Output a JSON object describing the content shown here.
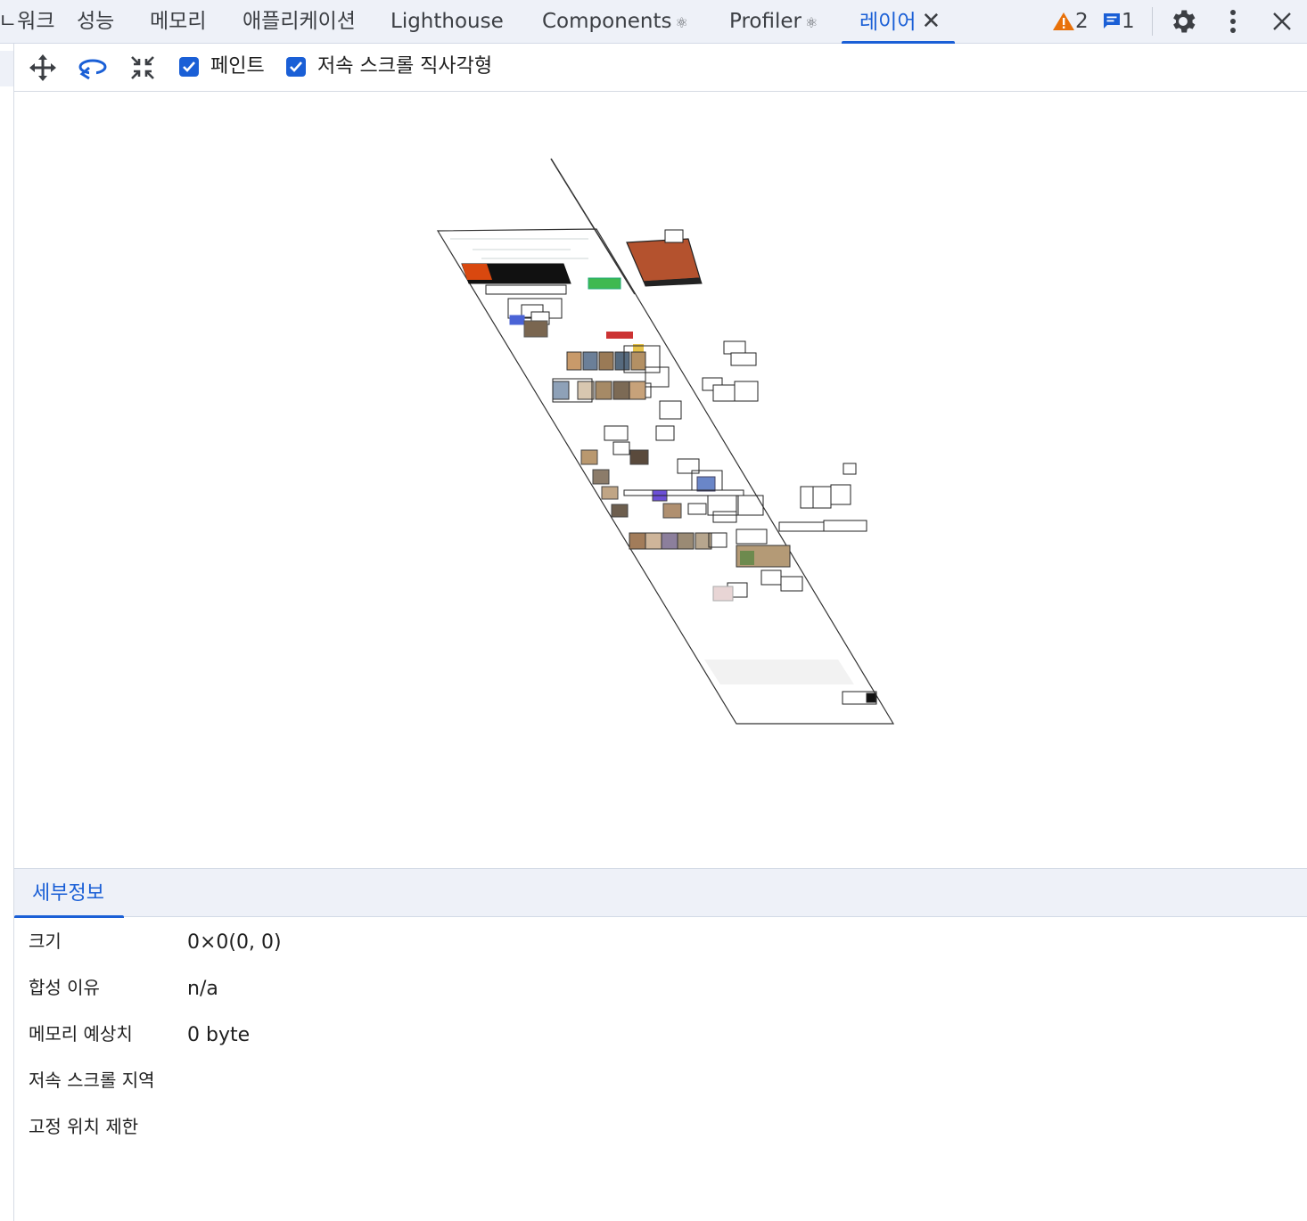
{
  "tabs": [
    {
      "label": "ㄴ워크"
    },
    {
      "label": "성능"
    },
    {
      "label": "메모리"
    },
    {
      "label": "애플리케이션"
    },
    {
      "label": "Lighthouse"
    },
    {
      "label": "Components",
      "react_icon": "⚛"
    },
    {
      "label": "Profiler",
      "react_icon": "⚛"
    },
    {
      "label": "레이어",
      "close_icon": "✕"
    }
  ],
  "status": {
    "warnings": "2",
    "messages": "1"
  },
  "toolbar": {
    "pan_icon": "move-icon",
    "rotate_icon": "rotate-icon",
    "reset_icon": "reset-transform-icon",
    "paint_label": "페인트",
    "slow_scroll_label": "저속 스크롤 직사각형"
  },
  "details": {
    "tab_label": "세부정보",
    "rows": [
      {
        "key": "크기",
        "value": "0×0(0, 0)"
      },
      {
        "key": "합성 이유",
        "value": "n/a"
      },
      {
        "key": "메모리 예상치",
        "value": "0 byte"
      },
      {
        "key": "저속 스크롤 지역",
        "value": ""
      },
      {
        "key": "고정 위치 제한",
        "value": ""
      }
    ]
  },
  "colors": {
    "accent": "#1a5fd6",
    "warning": "#e8710a",
    "tabbar_bg": "#eef1f8"
  }
}
